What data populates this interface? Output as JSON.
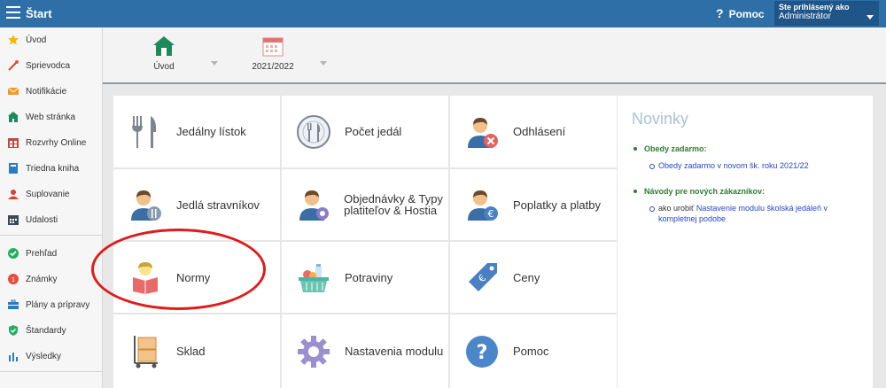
{
  "header": {
    "title": "Štart",
    "help_label": "Pomoc",
    "user_line1": "Ste prihlásený ako",
    "user_line2": "Administrátor"
  },
  "sidebar": {
    "items": [
      {
        "label": "Úvod",
        "icon": "star-icon"
      },
      {
        "label": "Sprievodca",
        "icon": "magic-wand-icon"
      },
      {
        "label": "Notifikácie",
        "icon": "envelope-icon"
      },
      {
        "label": "Web stránka",
        "icon": "home-icon"
      },
      {
        "label": "Rozvrhy Online",
        "icon": "calendar-grid-icon"
      },
      {
        "label": "Triedna kniha",
        "icon": "book-icon"
      },
      {
        "label": "Suplovanie",
        "icon": "person-icon"
      },
      {
        "label": "Udalosti",
        "icon": "calendar-icon"
      },
      {
        "label": "Prehľad",
        "icon": "check-circle-icon"
      },
      {
        "label": "Známky",
        "icon": "grade-icon"
      },
      {
        "label": "Plány a prípravy",
        "icon": "briefcase-icon"
      },
      {
        "label": "Štandardy",
        "icon": "shield-check-icon"
      },
      {
        "label": "Výsledky",
        "icon": "bar-chart-icon"
      }
    ]
  },
  "toolbar": {
    "home_label": "Úvod",
    "year_label": "2021/2022"
  },
  "tiles": [
    {
      "label": "Jedálny lístok",
      "icon": "cutlery-icon"
    },
    {
      "label": "Počet jedál",
      "icon": "plate-cutlery-icon"
    },
    {
      "label": "Odhlásení",
      "icon": "user-remove-icon"
    },
    {
      "label": "Jedlá stravníkov",
      "icon": "user-cutlery-icon"
    },
    {
      "label": "Objednávky & Typy platiteľov & Hostia",
      "icon": "user-settings-icon"
    },
    {
      "label": "Poplatky a platby",
      "icon": "user-euro-icon"
    },
    {
      "label": "Normy",
      "icon": "reader-book-icon"
    },
    {
      "label": "Potraviny",
      "icon": "grocery-basket-icon"
    },
    {
      "label": "Ceny",
      "icon": "price-tag-euro-icon"
    },
    {
      "label": "Sklad",
      "icon": "boxes-cart-icon"
    },
    {
      "label": "Nastavenia modulu",
      "icon": "gear-icon"
    },
    {
      "label": "Pomoc",
      "icon": "question-circle-icon"
    }
  ],
  "news": {
    "title": "Novinky",
    "section1": "Obedy zadarmo:",
    "link1": "Obedy zadarmo v novom šk. roku 2021/22",
    "section2": "Návody pre nových zákazníkov:",
    "link2_prefix": "ako urobiť",
    "link2": "Nastavenie modulu školská jedáleň v kompletnej podobe"
  },
  "colors": {
    "topbar": "#2e6fa8",
    "accent_green": "#2e7d32",
    "link_blue": "#2747c6",
    "annotation_red": "#e01b1b"
  }
}
